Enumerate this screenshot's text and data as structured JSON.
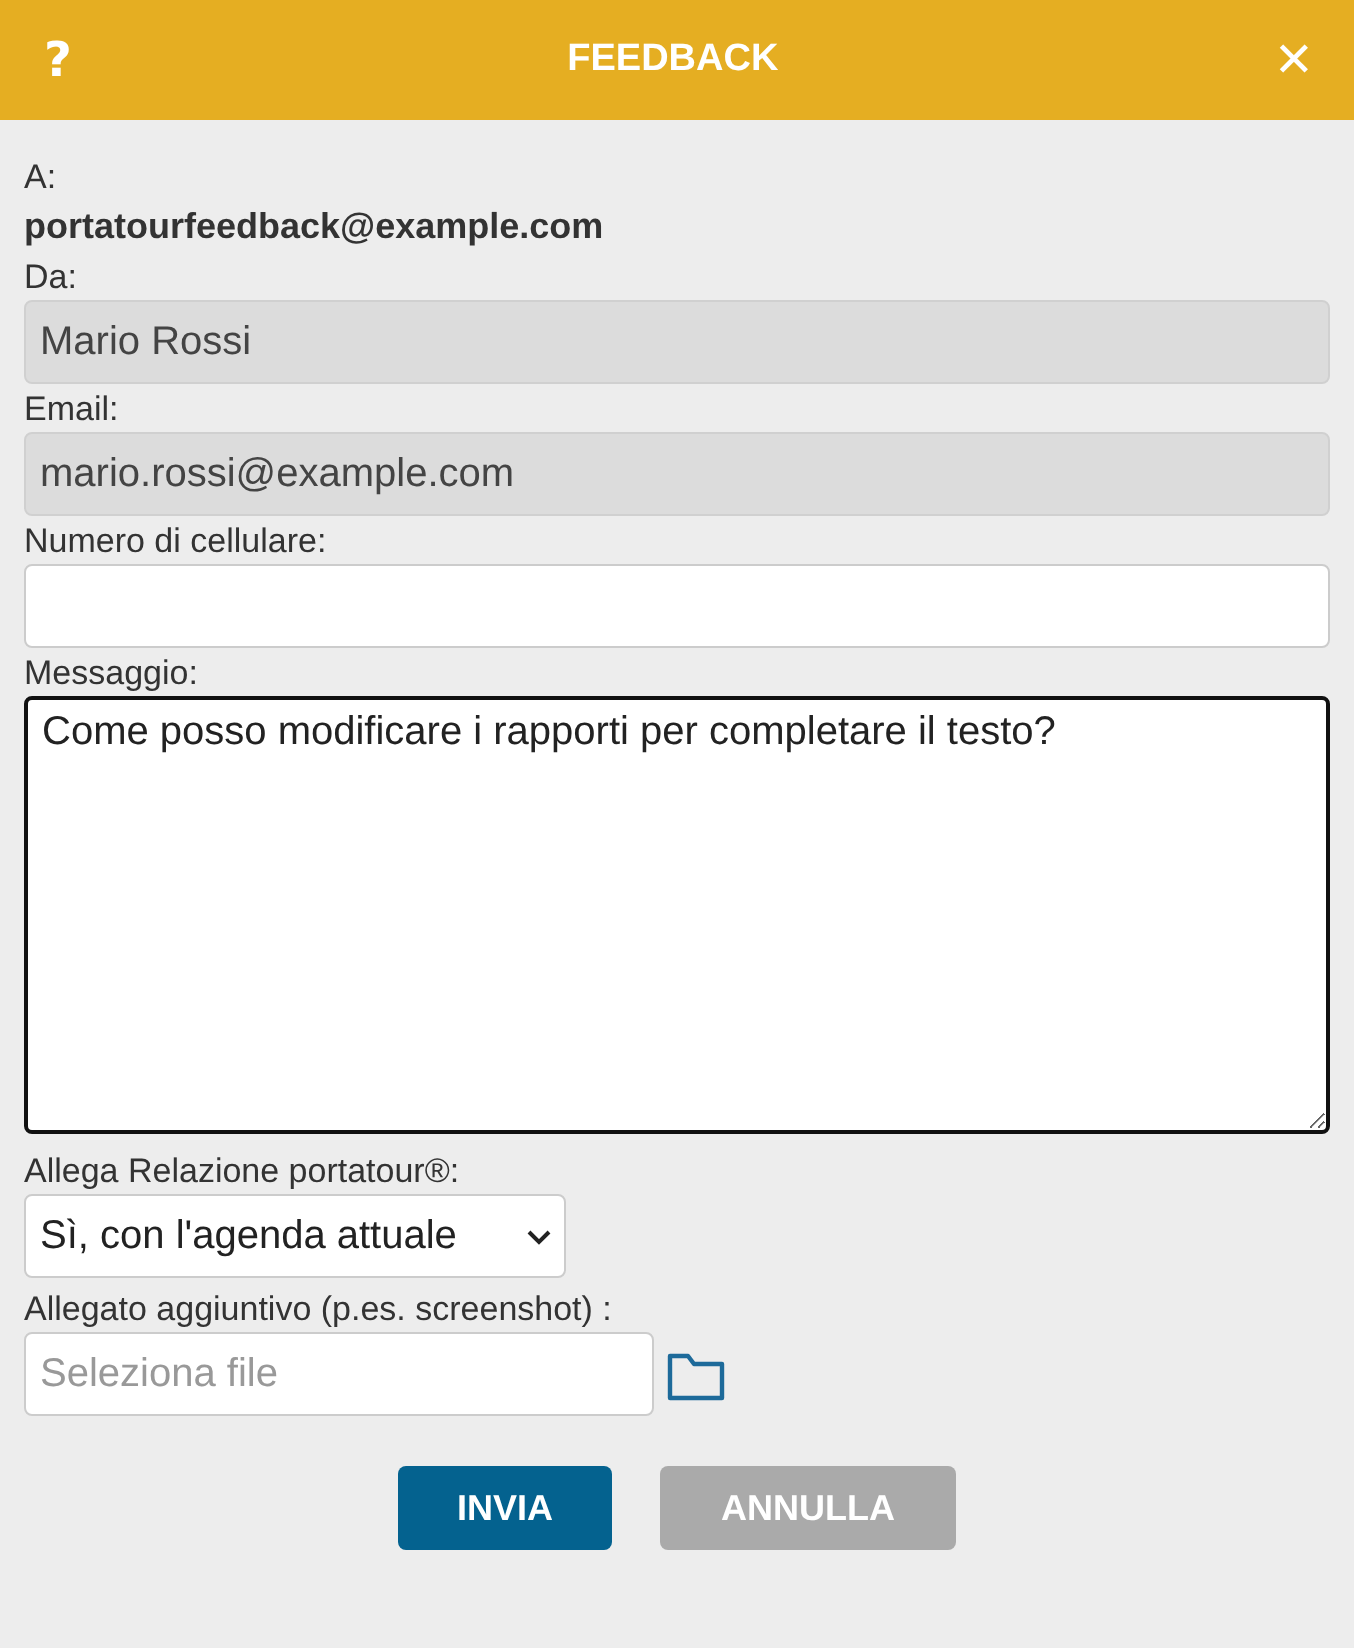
{
  "dialog": {
    "help_icon": "?",
    "title": "FEEDBACK",
    "close_icon": "✕"
  },
  "recipient": {
    "label": "A:",
    "address": "portatourfeedback@example.com"
  },
  "fields": [
    {
      "kind": "text",
      "label": "Da:",
      "value": "Mario Rossi",
      "disabled": true
    },
    {
      "kind": "text",
      "label": "Email:",
      "value": "mario.rossi@example.com",
      "disabled": true
    },
    {
      "kind": "text",
      "label": "Numero di cellulare:",
      "disabled": false
    },
    {
      "kind": "textarea",
      "label": "Messaggio:",
      "value": "Come posso modificare i rapporti per completare il testo?",
      "disabled": false,
      "focused": true
    },
    {
      "kind": "select",
      "label": "Allega Relazione portatour®:",
      "value": "Sì, con l'agenda attuale"
    },
    {
      "kind": "file",
      "label": "Allegato aggiuntivo (p.es. screenshot) :",
      "placeholder": "Seleziona file"
    }
  ],
  "buttons": [
    {
      "label": "INVIA",
      "kind": "primary"
    },
    {
      "label": "ANNULLA",
      "kind": "secondary"
    }
  ]
}
